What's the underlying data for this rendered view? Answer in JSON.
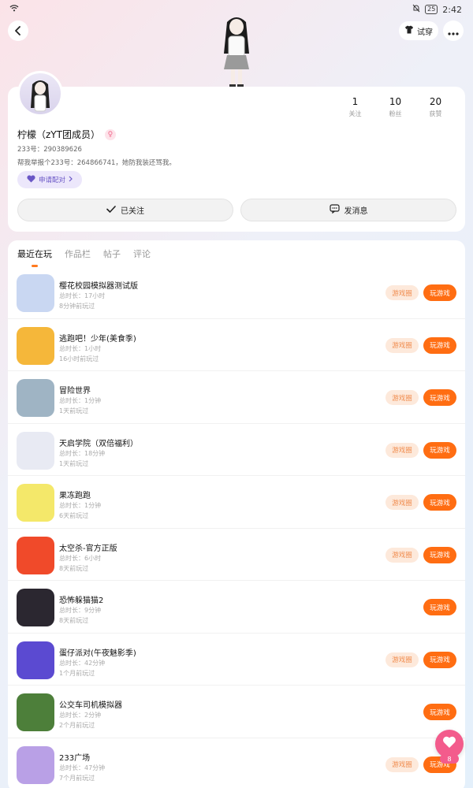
{
  "status_bar": {
    "battery": "25",
    "time": "2:42"
  },
  "header": {
    "tryon_label": "试穿"
  },
  "profile": {
    "stats": [
      {
        "value": "1",
        "label": "关注"
      },
      {
        "value": "10",
        "label": "粉丝"
      },
      {
        "value": "20",
        "label": "获赞"
      }
    ],
    "username": "柠檬（zYT团成员）",
    "user_id": "233号：290389626",
    "bio": "帮我举报个233号：264866741，她防我装还骂我。",
    "pair_label": "申请配对",
    "follow_label": "已关注",
    "message_label": "发消息"
  },
  "tabs": [
    {
      "label": "最近在玩"
    },
    {
      "label": "作品栏"
    },
    {
      "label": "帖子"
    },
    {
      "label": "评论"
    }
  ],
  "games": [
    {
      "name": "樱花校园模拟器测试版",
      "duration": "总时长：17小时",
      "last_played": "8分钟前玩过",
      "circle_label": "游戏圈",
      "play_label": "玩游戏",
      "icon_color": "#c9d7f2"
    },
    {
      "name": "逃跑吧！少年(美食季)",
      "duration": "总时长：1小时",
      "last_played": "16小时前玩过",
      "circle_label": "游戏圈",
      "play_label": "玩游戏",
      "icon_color": "#f5b73a"
    },
    {
      "name": "冒险世界",
      "duration": "总时长：1分钟",
      "last_played": "1天前玩过",
      "circle_label": "游戏圈",
      "play_label": "玩游戏",
      "icon_color": "#9fb4c4"
    },
    {
      "name": "天启学院（双倍福利）",
      "duration": "总时长：18分钟",
      "last_played": "1天前玩过",
      "circle_label": "游戏圈",
      "play_label": "玩游戏",
      "icon_color": "#e8eaf3"
    },
    {
      "name": "果冻跑跑",
      "duration": "总时长：1分钟",
      "last_played": "6天前玩过",
      "circle_label": "游戏圈",
      "play_label": "玩游戏",
      "icon_color": "#f4e86a"
    },
    {
      "name": "太空杀-官方正版",
      "duration": "总时长：6小时",
      "last_played": "8天前玩过",
      "circle_label": "游戏圈",
      "play_label": "玩游戏",
      "icon_color": "#f04a2a"
    },
    {
      "name": "恐怖躲猫猫2",
      "duration": "总时长：9分钟",
      "last_played": "8天前玩过",
      "circle_label": "",
      "play_label": "玩游戏",
      "icon_color": "#2b2730"
    },
    {
      "name": "蛋仔派对(午夜魅影季)",
      "duration": "总时长：42分钟",
      "last_played": "1个月前玩过",
      "circle_label": "游戏圈",
      "play_label": "玩游戏",
      "icon_color": "#5b4ad1"
    },
    {
      "name": "公交车司机模拟器",
      "duration": "总时长：2分钟",
      "last_played": "2个月前玩过",
      "circle_label": "",
      "play_label": "玩游戏",
      "icon_color": "#4d7f3a"
    },
    {
      "name": "233广场",
      "duration": "总时长：47分钟",
      "last_played": "7个月前玩过",
      "circle_label": "游戏圈",
      "play_label": "玩游戏",
      "icon_color": "#b9a0e6"
    }
  ],
  "float_like": {
    "count": "8"
  }
}
